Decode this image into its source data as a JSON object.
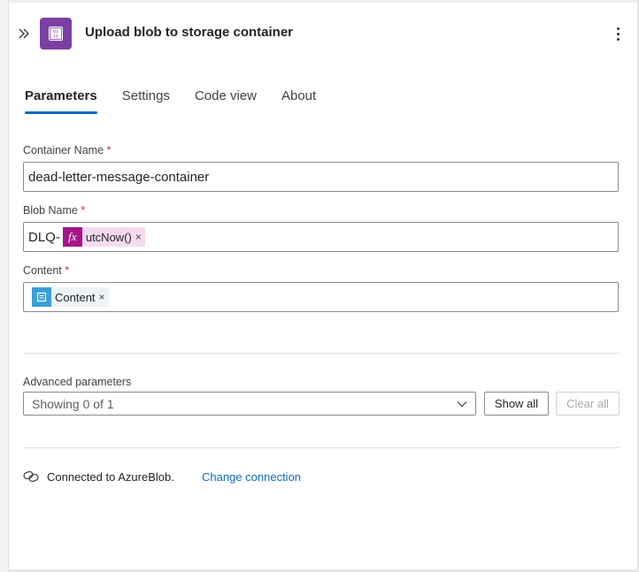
{
  "header": {
    "title": "Upload blob to storage container",
    "collapse_icon": "double-chevron-right-icon",
    "app_icon": "azure-blob-icon",
    "more_icon": "more-vertical-icon",
    "app_icon_color": "#7b3fa3"
  },
  "tabs": [
    {
      "label": "Parameters",
      "active": true
    },
    {
      "label": "Settings",
      "active": false
    },
    {
      "label": "Code view",
      "active": false
    },
    {
      "label": "About",
      "active": false
    }
  ],
  "fields": {
    "container_name": {
      "label": "Container Name",
      "required": "*",
      "value": "dead-letter-message-container"
    },
    "blob_name": {
      "label": "Blob Name",
      "required": "*",
      "prefix": "DLQ-",
      "token": {
        "icon_text": "fx",
        "label": "utcNow()",
        "remove": "×",
        "color": "#a3168a"
      }
    },
    "content": {
      "label": "Content",
      "required": "*",
      "token": {
        "label": "Content",
        "remove": "×",
        "icon": "document-icon",
        "color": "#3aa0d6"
      }
    }
  },
  "advanced": {
    "label": "Advanced parameters",
    "dropdown_value": "Showing 0 of 1",
    "show_all": "Show all",
    "clear_all": "Clear all"
  },
  "connection": {
    "icon": "link-icon",
    "text": "Connected to AzureBlob.",
    "change_link": "Change connection"
  },
  "colors": {
    "accent": "#0f6cbd",
    "required": "#c4314b"
  }
}
